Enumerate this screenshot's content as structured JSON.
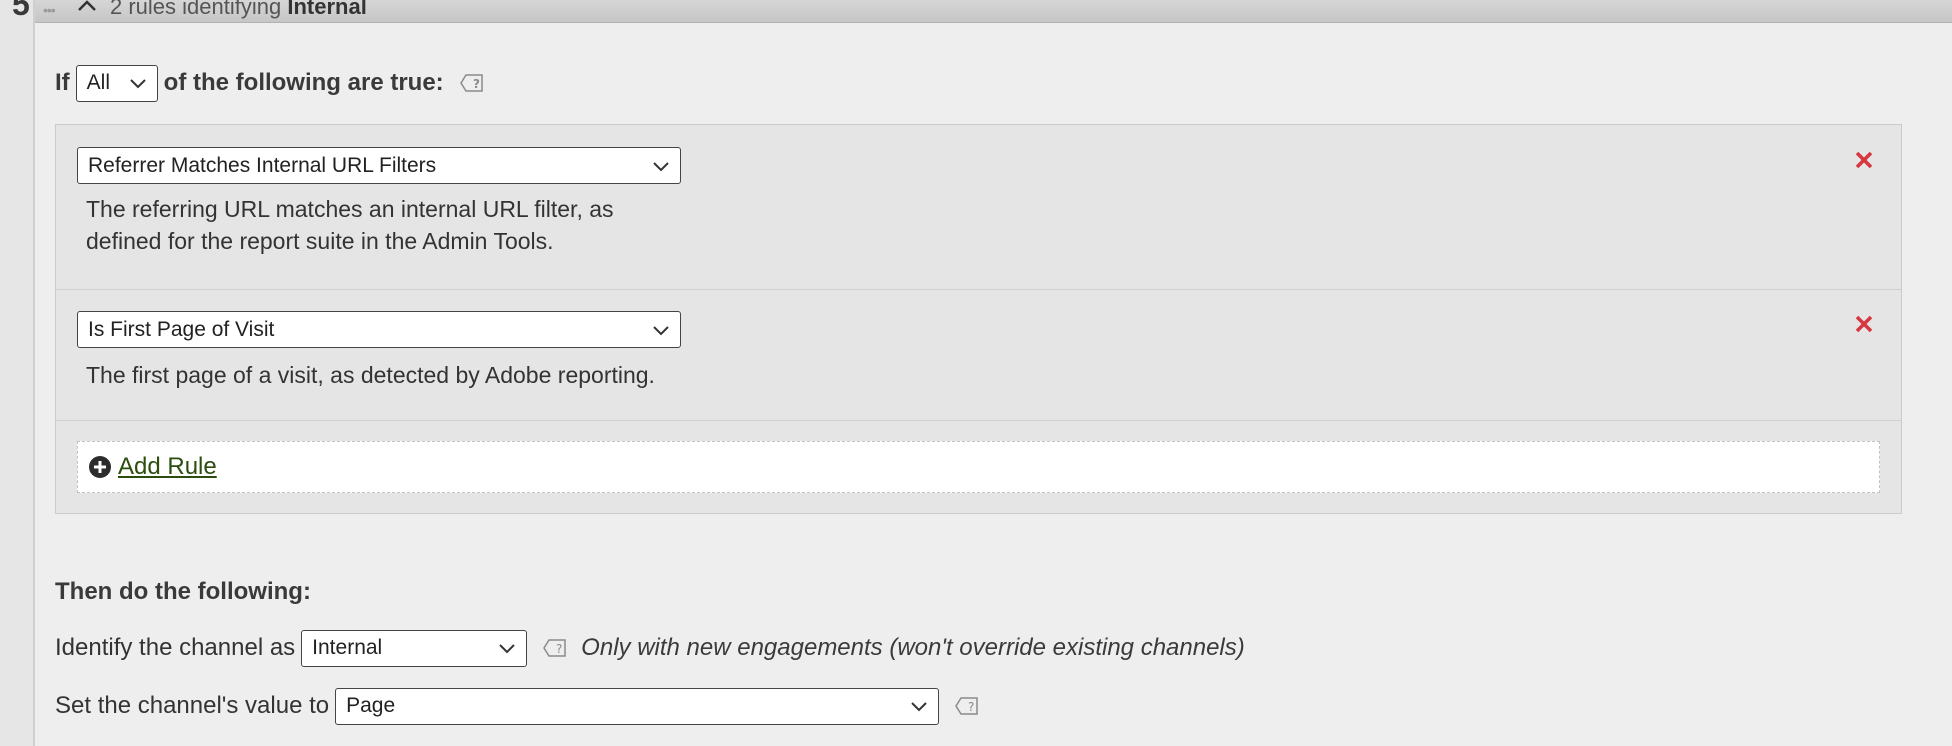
{
  "section_number": "5",
  "header": {
    "text_prefix": "2 rules identifying",
    "text_bold": "Internal"
  },
  "condition": {
    "label_if": "If",
    "match_select_value": "All",
    "label_suffix": "of the following are true:"
  },
  "rules": [
    {
      "select_value": "Referrer Matches Internal URL Filters",
      "description_line1": "The referring URL matches an internal URL filter, as",
      "description_line2": "defined for the report suite in the Admin Tools."
    },
    {
      "select_value": "Is First Page of Visit",
      "description_line1": "The first page of a visit, as detected by Adobe reporting."
    }
  ],
  "add_rule_label": "Add Rule",
  "then": {
    "title": "Then do the following:",
    "identify_label": "Identify the channel as",
    "identify_value": "Internal",
    "identify_note": "Only with new engagements (won't override existing channels)",
    "value_label": "Set the channel's value to",
    "value_value": "Page"
  },
  "colors": {
    "remove": "#d7373f",
    "link": "#2b4e0f",
    "panel_bg": "#eeeeee",
    "rules_bg": "#e5e5e5"
  },
  "icons": [
    "grip-icon",
    "collapse-chevron-icon",
    "help-icon",
    "chevron-down-icon",
    "remove-icon",
    "add-circle-icon"
  ]
}
